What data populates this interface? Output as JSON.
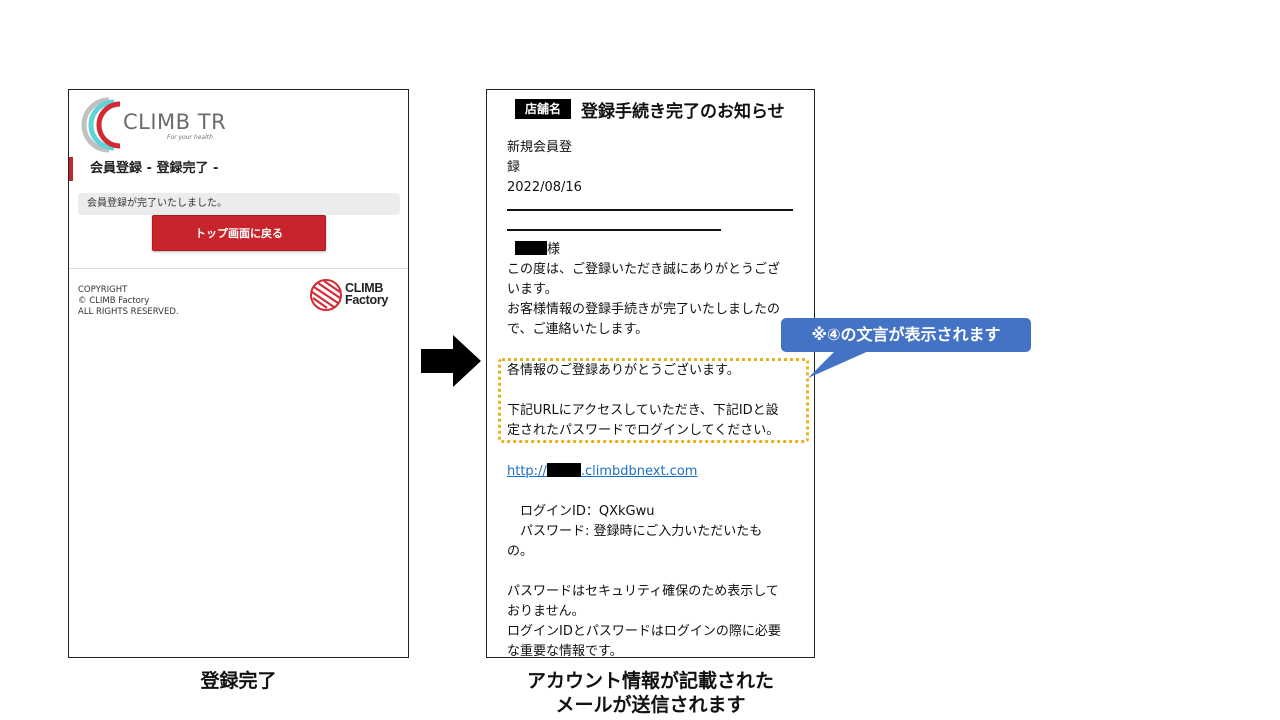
{
  "left_panel": {
    "logo": {
      "name": "CLIMB TR",
      "tagline": "For your health"
    },
    "heading": "会員登録 - 登録完了 -",
    "notice": "会員登録が完了いたしました。",
    "top_button_label": "トップ画面に戻る",
    "copyright_lines": [
      "COPYRIGHT",
      "© CLIMB Factory",
      "ALL RIGHTS RESERVED."
    ],
    "footer_logo": {
      "line1": "CLIMB",
      "line2": "Factory"
    },
    "caption": "登録完了"
  },
  "arrow_icon": "right-arrow-icon",
  "right_panel": {
    "shop_badge": "店舗名",
    "subject": "登録手続き完了のお知らせ",
    "meta_lines": [
      "新規会員登",
      "録",
      "2022/08/16"
    ],
    "greeting_suffix": "様",
    "intro": [
      "この度は、ご登録いただき誠にありがとうござ",
      "います。",
      "お客様情報の登録手続きが完了いたしましたの",
      "で、ご連絡いたします。"
    ],
    "highlight_lines": [
      "各情報のご登録ありがとうございます。",
      "",
      "下記URLにアクセスしていただき、下記IDと設",
      "定されたパスワードでログインしてください。"
    ],
    "link": {
      "prefix": "http://",
      "suffix": ".climbdbnext.com"
    },
    "login_id": "　ログインID：QXkGwu",
    "password_lines": [
      "　パスワード: 登録時にご入力いただいたも",
      "の。"
    ],
    "security_lines": [
      "パスワードはセキュリティ確保のため表示して",
      "おりません。",
      "ログインIDとパスワードはログインの際に必要",
      "な重要な情報です。"
    ],
    "caption_lines": [
      "アカウント情報が記載された",
      "メールが送信されます"
    ]
  },
  "callout": {
    "text": "※④の文言が表示されます",
    "color": "#4472c4"
  },
  "colors": {
    "brand_red": "#c8242b",
    "highlight": "#e8b21a",
    "link": "#1a6fc9"
  }
}
